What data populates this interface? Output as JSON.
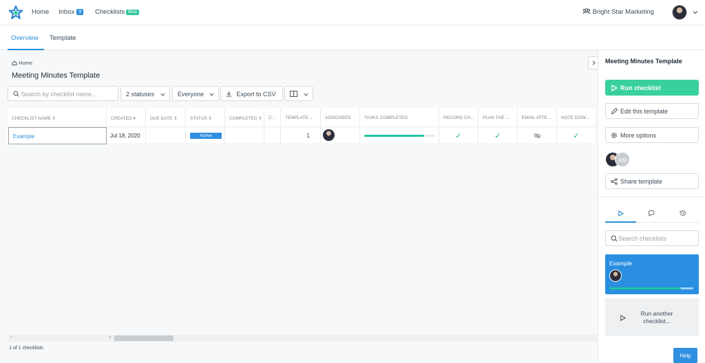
{
  "topnav": {
    "home": "Home",
    "inbox": "Inbox",
    "inbox_count": "9",
    "checklists": "Checklists",
    "beta": "Beta",
    "org": "Bright Star Marketing"
  },
  "tabs": {
    "overview": "Overview",
    "template": "Template"
  },
  "breadcrumb": "Home",
  "page_title": "Meeting Minutes Template",
  "toolbar": {
    "search_placeholder": "Search by checklist name...",
    "statuses": "2 statuses",
    "assignee_filter": "Everyone",
    "export": "Export to CSV"
  },
  "table": {
    "headers": [
      "CHECKLIST NAME",
      "CREATED",
      "DUE DATE",
      "STATUS",
      "COMPLETED",
      "C...",
      "TEMPLATE ...",
      "ASSIGNEES",
      "TASKS COMPLETED",
      "RECORD CH...",
      "PLAN THE ...",
      "EMAIL ATTE...",
      "NOTE DOW..."
    ],
    "row": {
      "name": "Example",
      "created": "Jul 18, 2020",
      "status": "Active",
      "template_count": "1",
      "progress": 0.85
    }
  },
  "footer": "1 of 1 checklists",
  "sidebar": {
    "title": "Meeting Minutes Template",
    "run": "Run checklist",
    "edit": "Edit this template",
    "more": "More options",
    "avatar_initials": "AM",
    "share": "Share template",
    "search_placeholder": "Search checklists",
    "card_title": "Example",
    "run_another": "Run another checklist..."
  },
  "help": "Help",
  "colors": {
    "accent": "#2a8fd8",
    "success": "#39d09f",
    "badge": "#2f8fe0"
  }
}
